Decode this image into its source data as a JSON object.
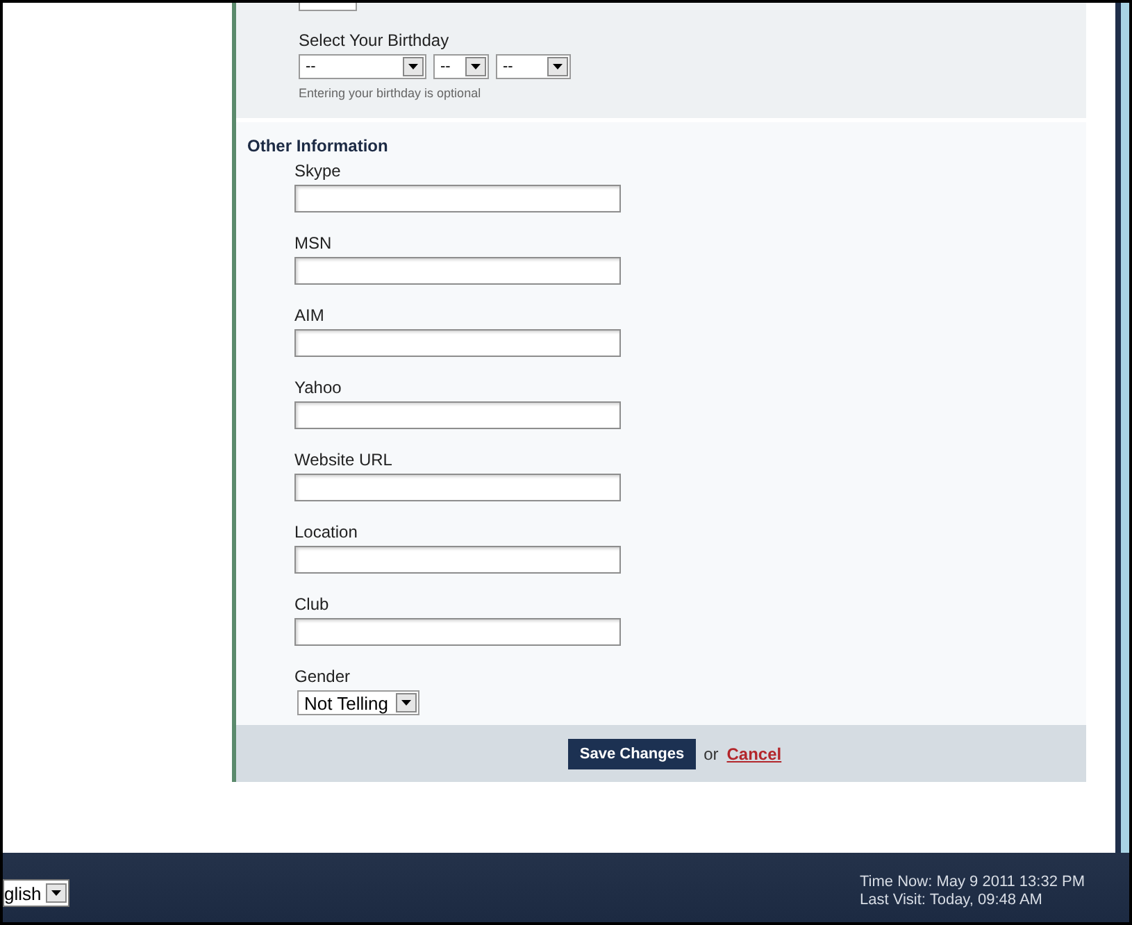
{
  "birthday": {
    "label": "Select Your Birthday",
    "selects": [
      {
        "value": "--"
      },
      {
        "value": "--"
      },
      {
        "value": "--"
      }
    ],
    "hint": "Entering your birthday is optional"
  },
  "other_information": {
    "heading": "Other Information",
    "fields": [
      {
        "label": "Skype"
      },
      {
        "label": "MSN"
      },
      {
        "label": "AIM"
      },
      {
        "label": "Yahoo"
      },
      {
        "label": "Website URL"
      },
      {
        "label": "Location"
      },
      {
        "label": "Club"
      }
    ],
    "gender": {
      "label": "Gender",
      "value": "Not Telling"
    }
  },
  "actions": {
    "save": "Save Changes",
    "separator": "or",
    "cancel": "Cancel"
  },
  "footer": {
    "language": "glish",
    "time_now": "Time Now: May 9 2011 13:32 PM",
    "last_visit": "Last Visit: Today, 09:48 AM"
  }
}
